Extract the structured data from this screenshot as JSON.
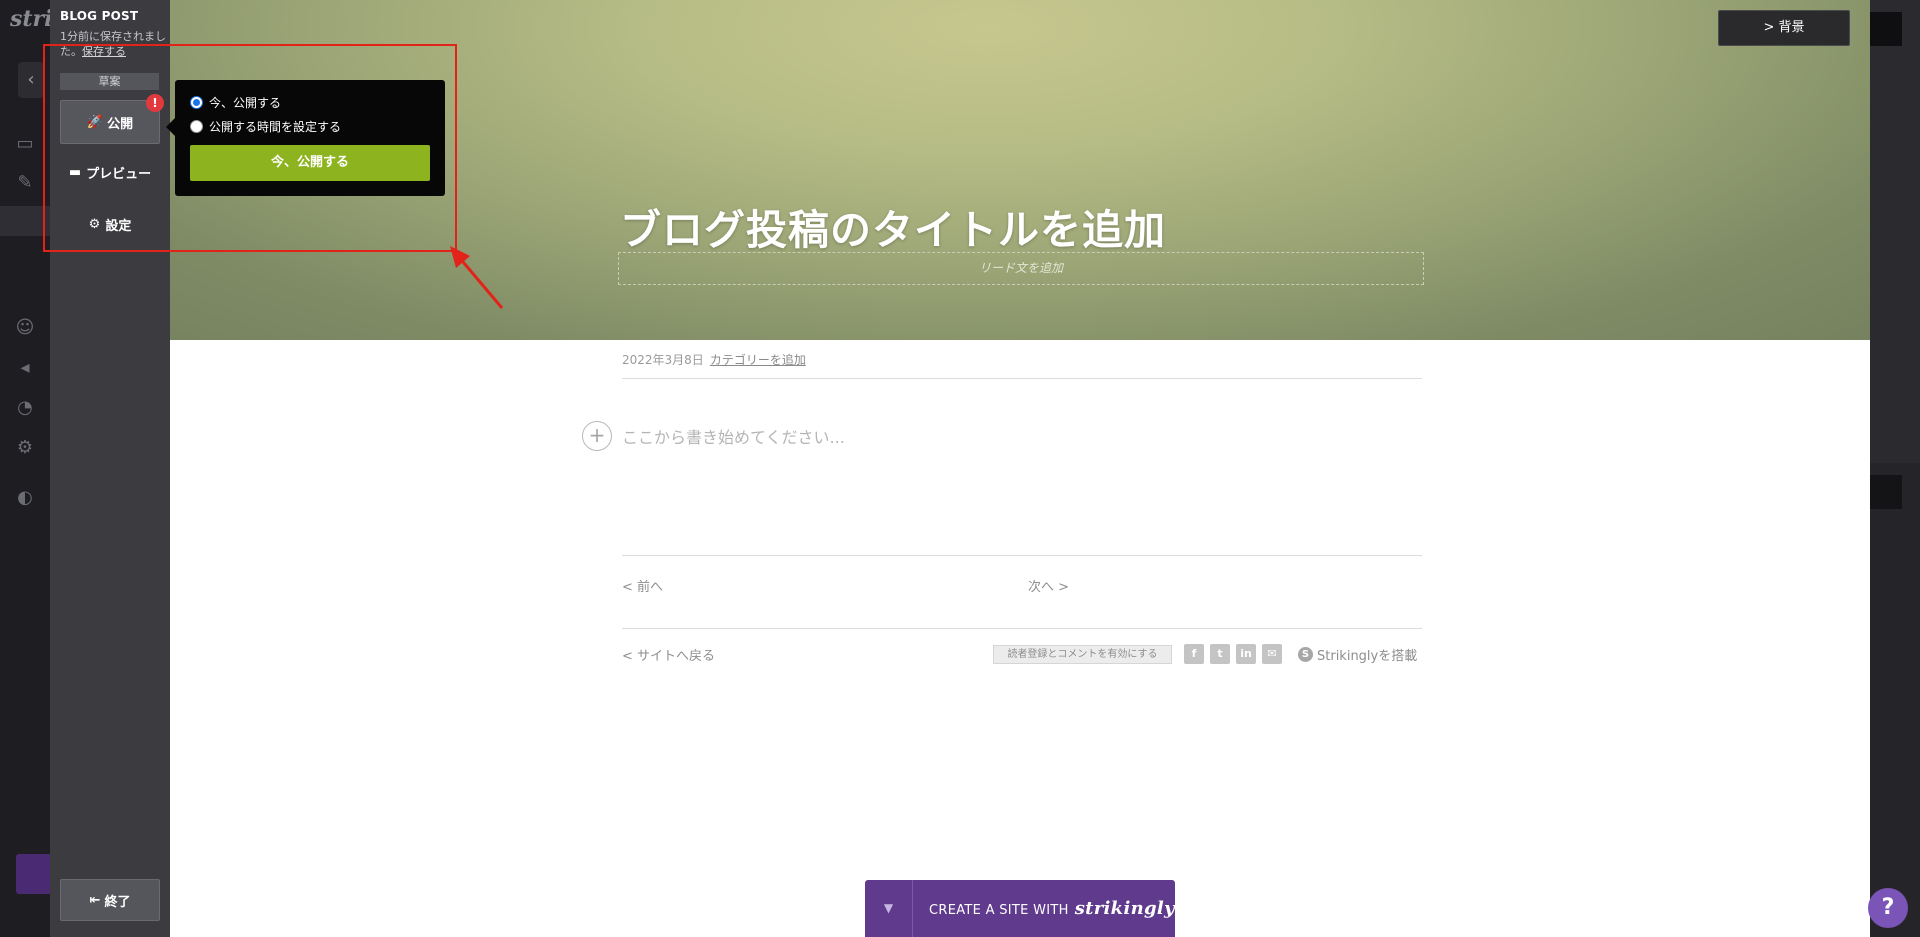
{
  "dashboard": {
    "logo": "strik"
  },
  "panel": {
    "title": "BLOG POST",
    "save_status": "1分前に保存されました。",
    "save_link": "保存する",
    "draft_badge": "草案",
    "publish_label": "公開",
    "alert": "!",
    "preview_label": "プレビュー",
    "settings_label": "設定",
    "exit_label": "終了"
  },
  "publish_popup": {
    "options": [
      {
        "label": "今、公開する",
        "selected": true
      },
      {
        "label": "公開する時間を設定する",
        "selected": false
      }
    ],
    "confirm_label": "今、公開する"
  },
  "hero": {
    "background_button": "> 背景",
    "title": "ブログ投稿のタイトルを追加",
    "lead_placeholder": "リード文を追加"
  },
  "post": {
    "date": "2022年3月8日",
    "category_link": "カテゴリーを追加",
    "body_placeholder": "ここから書き始めてください...",
    "prev": "< 前へ",
    "next": "次へ >",
    "back_to_site": "< サイトへ戻る",
    "enable_comments": "読者登録とコメントを有効にする",
    "social_icons": [
      "facebook-icon",
      "twitter-icon",
      "linkedin-icon",
      "email-icon"
    ],
    "powered_by": "Strikinglyを搭載"
  },
  "footer_bar": {
    "prefix": "CREATE A SITE WITH",
    "brand": "strikingly"
  },
  "help": {
    "label": "?"
  },
  "colors": {
    "publish_green": "#8db31e",
    "annotation_red": "#e2231a",
    "brand_purple": "#5f3a8d",
    "alert_red": "#e0393e"
  }
}
